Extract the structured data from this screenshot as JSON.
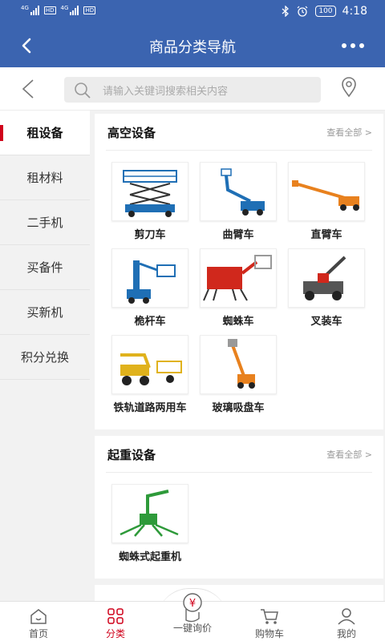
{
  "status": {
    "net1": "4G",
    "net2": "4G",
    "hd1": "HD",
    "hd2": "HD",
    "battery": "100",
    "time": "4:18"
  },
  "header": {
    "title": "商品分类导航"
  },
  "search": {
    "placeholder": "请输入关键词搜索相关内容"
  },
  "sidebar": {
    "items": [
      {
        "label": "租设备",
        "active": true
      },
      {
        "label": "租材料"
      },
      {
        "label": "二手机"
      },
      {
        "label": "买备件"
      },
      {
        "label": "买新机"
      },
      {
        "label": "积分兑换"
      }
    ]
  },
  "sections": [
    {
      "title": "高空设备",
      "view_all": "查看全部 >",
      "items": [
        {
          "label": "剪刀车",
          "icon": "scissor-lift-image"
        },
        {
          "label": "曲臂车",
          "icon": "articulating-boom-image"
        },
        {
          "label": "直臂车",
          "icon": "telescopic-boom-image"
        },
        {
          "label": "桅杆车",
          "icon": "mast-lift-image"
        },
        {
          "label": "蜘蛛车",
          "icon": "spider-lift-image"
        },
        {
          "label": "叉装车",
          "icon": "telehandler-image"
        },
        {
          "label": "铁轨道路两用车",
          "icon": "rail-road-vehicle-image"
        },
        {
          "label": "玻璃吸盘车",
          "icon": "glass-suction-lift-image"
        }
      ]
    },
    {
      "title": "起重设备",
      "view_all": "查看全部 >",
      "items": [
        {
          "label": "蜘蛛式起重机",
          "icon": "spider-crane-image"
        }
      ]
    }
  ],
  "tabs": [
    {
      "label": "首页",
      "icon": "home-icon"
    },
    {
      "label": "分类",
      "icon": "category-icon",
      "active": true
    },
    {
      "label": "一键询价",
      "icon": "inquiry-icon"
    },
    {
      "label": "购物车",
      "icon": "cart-icon"
    },
    {
      "label": "我的",
      "icon": "user-icon"
    }
  ],
  "colors": {
    "primary": "#3b64b0",
    "accent": "#d0021b"
  }
}
